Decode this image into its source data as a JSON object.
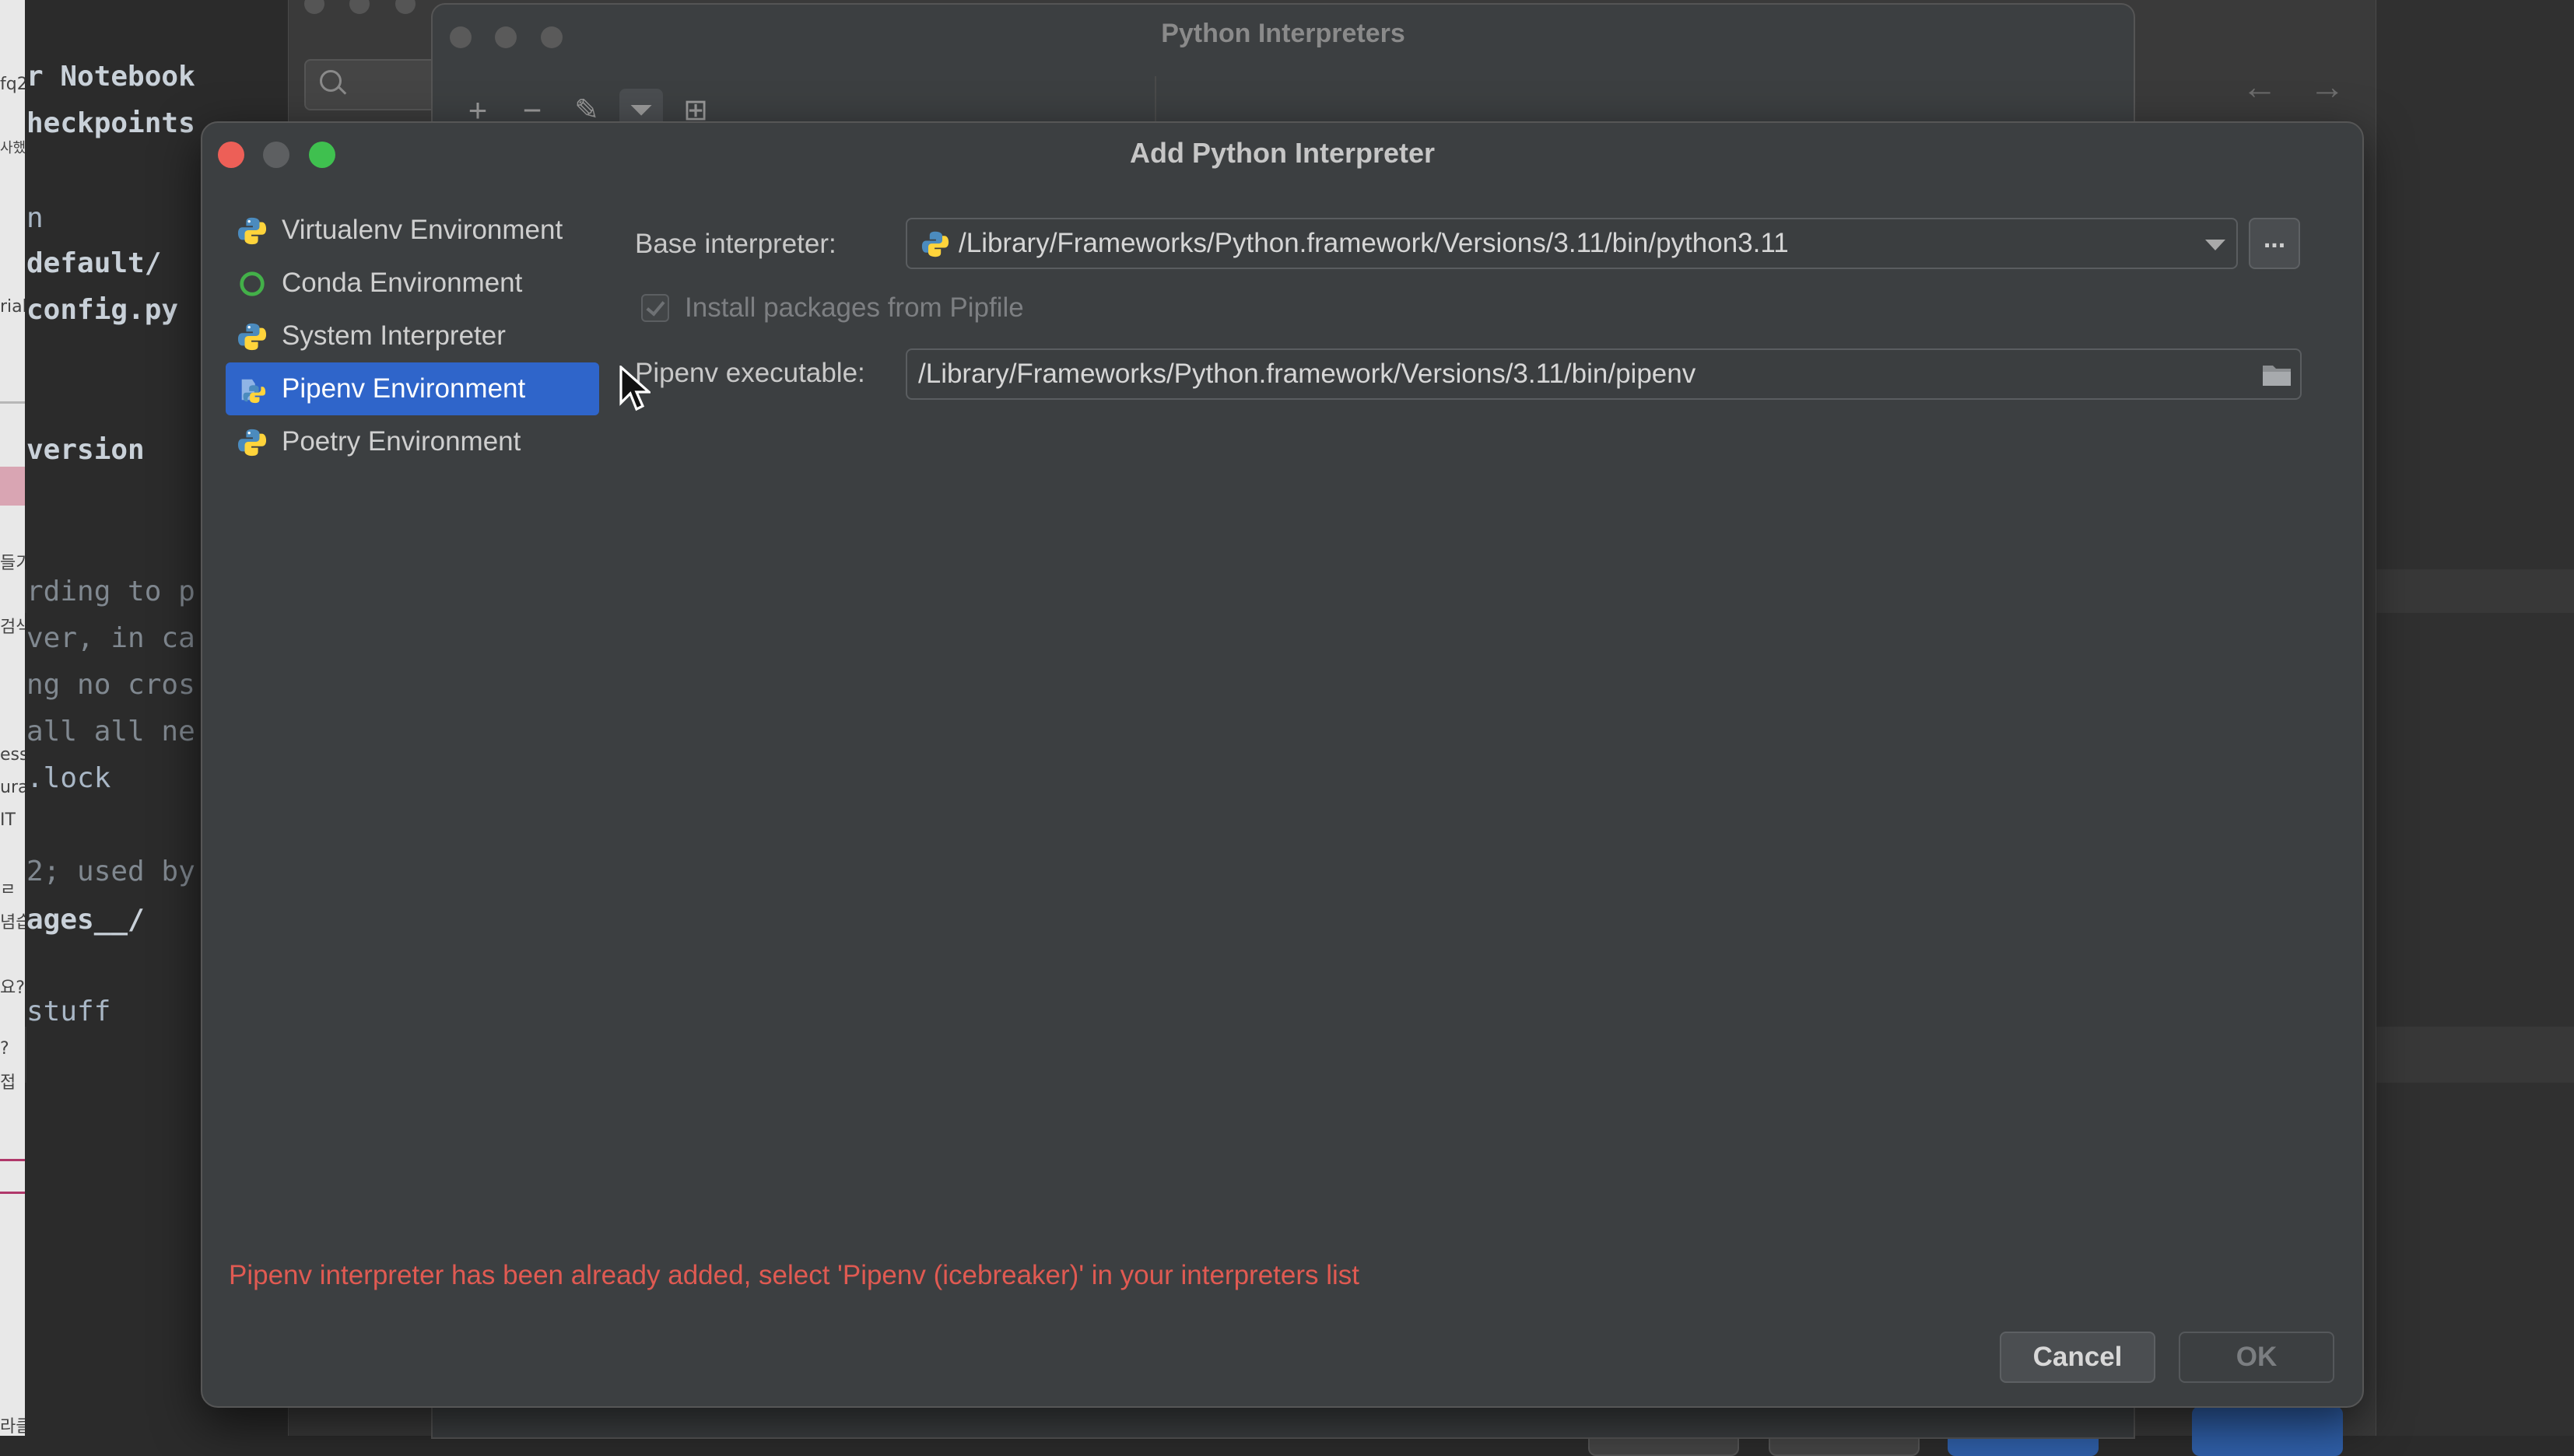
{
  "background_editor": {
    "code_lines": [
      "r Notebook",
      "heckpoints",
      "n",
      "default/",
      "config.py",
      "version",
      "rding to p",
      "ver, in ca",
      "ng no cros",
      "all all ne",
      ".lock",
      "2; used by",
      "ages__/",
      " stuff"
    ],
    "gutter_fragments": [
      "fq2",
      "사했",
      "rial",
      "들기",
      "검색",
      "ess",
      "ura",
      "IT ",
      "ㄹ",
      "념습",
      "요?",
      "?",
      "접",
      "라클"
    ]
  },
  "interpreters_window": {
    "title": "Python Interpreters",
    "toolbar": {
      "add": "+",
      "remove": "−",
      "edit": "✎",
      "filter": "⏷",
      "tree": "⊞"
    }
  },
  "settings_window": {
    "nav_back": "←",
    "nav_forward": "→"
  },
  "dialog": {
    "title": "Add Python Interpreter",
    "environments": [
      {
        "label": "Virtualenv Environment",
        "icon": "python-icon"
      },
      {
        "label": "Conda Environment",
        "icon": "conda-icon"
      },
      {
        "label": "System Interpreter",
        "icon": "python-icon"
      },
      {
        "label": "Pipenv Environment",
        "icon": "pipenv-icon",
        "selected": true
      },
      {
        "label": "Poetry Environment",
        "icon": "poetry-icon"
      }
    ],
    "base_interpreter": {
      "label": "Base interpreter:",
      "value": "/Library/Frameworks/Python.framework/Versions/3.11/bin/python3.11",
      "browse_label": "..."
    },
    "install_packages": {
      "label": "Install packages from Pipfile",
      "checked": true,
      "enabled": false
    },
    "pipenv_executable": {
      "label": "Pipenv executable:",
      "value": "/Library/Frameworks/Python.framework/Versions/3.11/bin/pipenv"
    },
    "error_message": "Pipenv interpreter has been already added, select 'Pipenv (icebreaker)' in your interpreters list",
    "buttons": {
      "cancel": "Cancel",
      "ok": "OK"
    }
  },
  "colors": {
    "selection": "#2f65ca",
    "error": "#e05a52",
    "dialog_bg": "#3c3f41",
    "close": "#ed5f57",
    "maximize": "#3fc04f"
  }
}
